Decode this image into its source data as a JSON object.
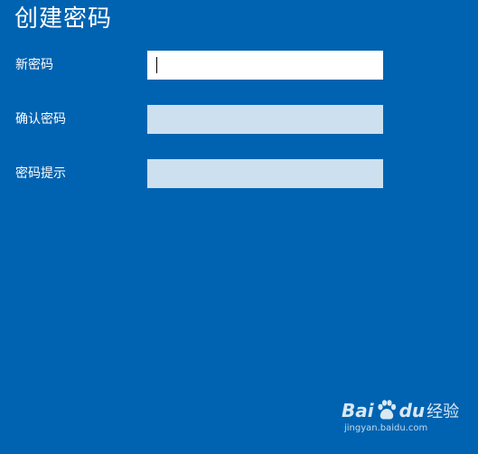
{
  "page": {
    "title": "创建密码",
    "background_color": "#0063b1"
  },
  "form": {
    "fields": [
      {
        "label": "新密码",
        "value": "",
        "state": "focused"
      },
      {
        "label": "确认密码",
        "value": "",
        "state": "unfocused"
      },
      {
        "label": "密码提示",
        "value": "",
        "state": "unfocused"
      }
    ]
  },
  "watermark": {
    "brand_left": "Bai",
    "paw_icon": "baidu-paw-icon",
    "brand_right": "du",
    "product": "经验",
    "url": "jingyan.baidu.com"
  }
}
